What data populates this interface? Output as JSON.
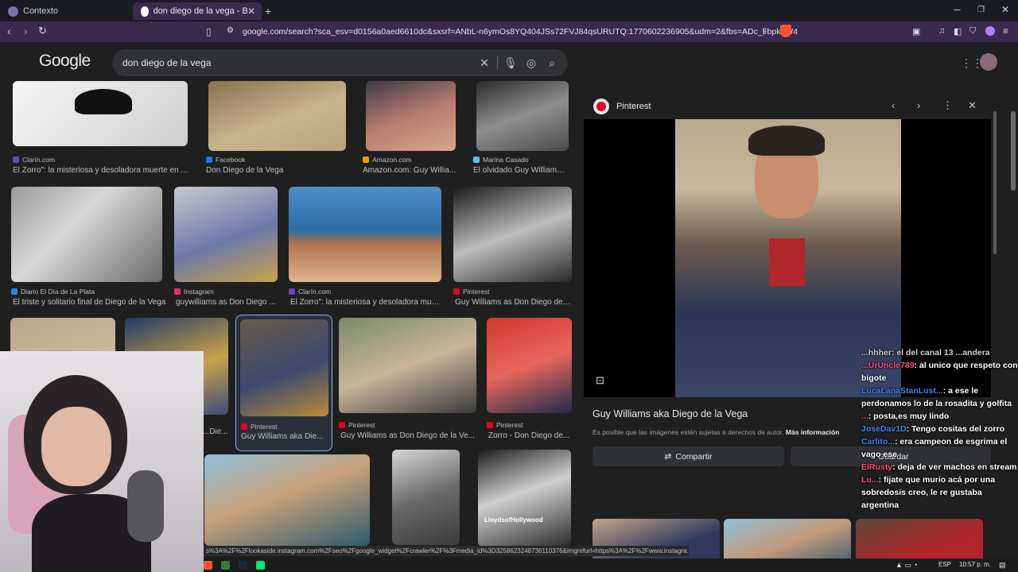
{
  "browser": {
    "tabs": [
      {
        "label": "Contexto",
        "active": false
      },
      {
        "label": "don diego de la vega - Buscar co",
        "active": true
      }
    ],
    "new_tab": "+",
    "url": "google.com/search?sca_esv=d0156a0aed6610dc&sxsrf=ANbL-n6ymOs8YQ404JSs72FVJ84qsURUTQ:1770602236905&udm=2&fbs=ADc_l-bpk8W4E-qsVl...",
    "status_url": "s%3A%2F%2Flookaside.instagram.com%2Fseo%2Fgoogle_widget%2Fcrawler%2F%3Fmedia_id%3D3258623248736110376&imgrefurl=https%3A%2F%2Fwww.instagra..."
  },
  "google": {
    "logo": "Google",
    "query": "don diego de la vega"
  },
  "results": {
    "row1": [
      {
        "source": "Clarín.com",
        "title": "El Zorro\": la misteriosa y desoladora muerte en Ar...",
        "fav": "#6f42c1"
      },
      {
        "source": "Facebook",
        "title": "Don Diego de la Vega",
        "fav": "#1877f2"
      },
      {
        "source": "Amazon.com",
        "title": "Amazon.com: Guy Willia...",
        "fav": "#ff9900"
      },
      {
        "source": "Marina Casado",
        "title": "El olvidado Guy Williams |...",
        "fav": "#4fc3f7"
      }
    ],
    "row2": [
      {
        "source": "Diario El Día de La Plata",
        "title": "El triste y solitario final de Diego de la Vega",
        "fav": "#1e88e5"
      },
      {
        "source": "Instagram",
        "title": "guywilliams as Don Diego ...",
        "fav": "#e1306c"
      },
      {
        "source": "Clarín.com",
        "title": "El Zorro\": la misteriosa y desoladora mue...",
        "fav": "#6f42c1"
      },
      {
        "source": "Pinterest",
        "title": "Guy Williams as Don Diego de ...",
        "fav": "#e60023"
      }
    ],
    "row3": [
      {
        "source": "",
        "title": "...Die...",
        "fav": "#e60023"
      },
      {
        "source": "Pinterest",
        "title": "Guy Williams aka Die...",
        "fav": "#e60023"
      },
      {
        "source": "Pinterest",
        "title": "Guy Williams as Don Diego de la Ve...",
        "fav": "#e60023"
      },
      {
        "source": "Pinterest",
        "title": "Zorro - Don Diego de...",
        "fav": "#e60023"
      }
    ],
    "watermark": "LloydsofHollywood"
  },
  "panel": {
    "source": "Pinterest",
    "title": "Guy Williams aka Diego de la Vega",
    "note": "Es posible que las imágenes estén sujetas a derechos de autor.",
    "note_link": "Más información",
    "share": "Compartir",
    "save": "Guardar"
  },
  "chat": [
    {
      "user": "...hhher",
      "text": ": el del canal 13 ...andera",
      "color": "#cfcfcf"
    },
    {
      "user": "...UrUncle789",
      "text": ": al unico que respeto con bigote",
      "color": "#ff4d6d"
    },
    {
      "user": "LucaLanaStanLust...",
      "text": ": a ese le perdonamos lo de la rosadita y golfita",
      "color": "#3b82f6"
    },
    {
      "user": "...",
      "text": ": posta,es muy lindo",
      "color": "#ff4d6d"
    },
    {
      "user": "JoseDav1D",
      "text": ": Tengo cositas del zorro",
      "color": "#3b82f6"
    },
    {
      "user": "Carlito...",
      "text": ": era campeon de esgrima el vago ese",
      "color": "#3b82f6"
    },
    {
      "user": "ElRusty",
      "text": ": deja de ver machos en stream",
      "color": "#ff4d6d"
    },
    {
      "user": "Lu...",
      "text": ": fijate que murio acá por una sobredosis creo, le re gustaba argentina",
      "color": "#ff4d6d"
    }
  ],
  "taskbar": {
    "lang": "ESP",
    "time": "10:57 p. m."
  }
}
